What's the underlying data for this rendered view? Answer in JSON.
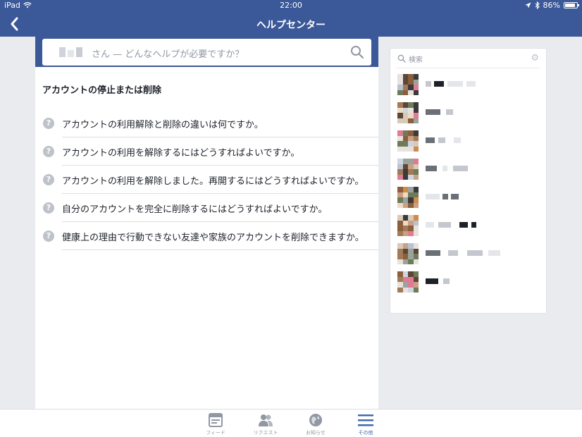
{
  "status_bar": {
    "device": "iPad",
    "time": "22:00",
    "battery": "86%",
    "battery_level": 0.86
  },
  "nav": {
    "title": "ヘルプセンター"
  },
  "search": {
    "placeholder": "さん — どんなヘルプが必要ですか？"
  },
  "section": {
    "title": "アカウントの停止または削除"
  },
  "faq": [
    {
      "text": "アカウントの利用解除と削除の違いは何ですか。"
    },
    {
      "text": "アカウントの利用を解除するにはどうすればよいですか。"
    },
    {
      "text": "アカウントの利用を解除しました。再開するにはどうすればよいですか。"
    },
    {
      "text": "自分のアカウントを完全に削除するにはどうすればよいですか。"
    },
    {
      "text": "健康上の理由で行動できない友達や家族のアカウントを削除できますか。"
    }
  ],
  "sidebar": {
    "search_label": "検索",
    "contacts_count_visible": 8
  },
  "tabbar": {
    "tabs": [
      {
        "label": "フィード",
        "icon": "feed-icon",
        "active": false
      },
      {
        "label": "リクエスト",
        "icon": "friend-requests-icon",
        "active": false
      },
      {
        "label": "お知らせ",
        "icon": "globe-notifications-icon",
        "active": false
      },
      {
        "label": "その他",
        "icon": "menu-icon",
        "active": true
      }
    ]
  },
  "colors": {
    "brand": "#3b5998",
    "active_tab": "#4267b2",
    "background": "#e9ebee"
  }
}
